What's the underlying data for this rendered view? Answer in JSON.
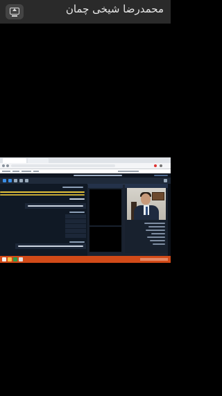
{
  "viewer": {
    "presenter_name": "محمدرضا شیخی چمان",
    "present_icon": "screen-share-icon"
  },
  "shared_screen": {
    "app_title": "",
    "main_text": "",
    "participants_label": "",
    "webcam_label": ""
  },
  "colors": {
    "taskbar": "#d14a18",
    "app_background": "#1b2331",
    "accent_yellow": "#e3c13a"
  }
}
